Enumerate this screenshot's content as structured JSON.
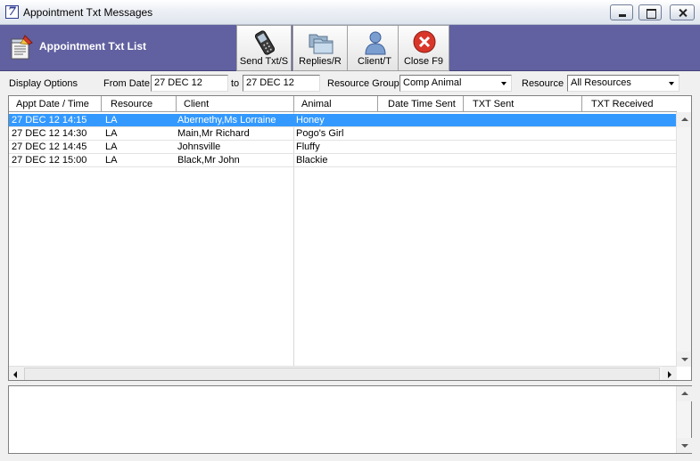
{
  "window": {
    "title": "Appointment Txt Messages"
  },
  "toolbar": {
    "title": "Appointment Txt List",
    "buttons": [
      {
        "label": "Send Txt/S",
        "icon": "mobile-phone-icon"
      },
      {
        "label": "Replies/R",
        "icon": "folders-icon"
      },
      {
        "label": "Client/T",
        "icon": "person-icon"
      },
      {
        "label": "Close F9",
        "icon": "close-circle-icon"
      }
    ],
    "color": "#6160a0"
  },
  "options": {
    "display_label": "Display Options",
    "from_label": "From Date",
    "from_value": "27 DEC 12",
    "to_label": "to",
    "to_value": "27 DEC 12",
    "group_label": "Resource Group",
    "group_value": "Comp Animal",
    "resource_label": "Resource",
    "resource_value": "All Resources"
  },
  "grid": {
    "columns": [
      "Appt Date / Time",
      "Resource",
      "Client",
      "Animal",
      "Date Time Sent",
      "TXT Sent",
      "TXT Received"
    ],
    "rows": [
      {
        "datetime": "27 DEC 12  14:15",
        "resource": "LA",
        "client": "Abernethy,Ms Lorraine",
        "animal": "Honey",
        "selected": true
      },
      {
        "datetime": "27 DEC 12  14:30",
        "resource": "LA",
        "client": "Main,Mr Richard",
        "animal": "Pogo's Girl",
        "selected": false
      },
      {
        "datetime": "27 DEC 12  14:45",
        "resource": "LA",
        "client": "Johnsville",
        "animal": "Fluffy",
        "selected": false
      },
      {
        "datetime": "27 DEC 12  15:00",
        "resource": "LA",
        "client": "Black,Mr John",
        "animal": "Blackie",
        "selected": false
      }
    ],
    "selection_color": "#3399ff"
  }
}
